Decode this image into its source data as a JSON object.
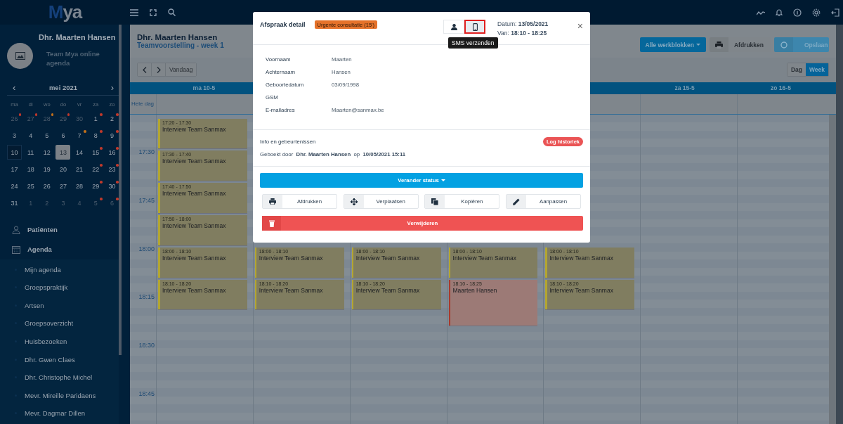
{
  "topbar": {
    "logo": "Mya"
  },
  "sidebar": {
    "profile": {
      "name": "Dhr. Maarten Hansen",
      "subtitle": "Team Mya online agenda"
    },
    "mini_calendar": {
      "month": "mei 2021",
      "prev": "‹",
      "next": "›",
      "weekdays": [
        "ma",
        "di",
        "wo",
        "do",
        "vr",
        "za",
        "zo"
      ],
      "weeks": [
        [
          {
            "day": "26",
            "other_month": true,
            "selected": false,
            "today": false,
            "color": "#c0392b"
          },
          {
            "day": "27",
            "other_month": true,
            "selected": false,
            "today": false,
            "color": "#c0392b"
          },
          {
            "day": "28",
            "other_month": true,
            "selected": false,
            "today": false,
            "color": "#c0701a"
          },
          {
            "day": "29",
            "other_month": true,
            "selected": false,
            "today": false,
            "color": "#c0392b"
          },
          {
            "day": "30",
            "other_month": true,
            "selected": false,
            "today": false
          },
          {
            "day": "1",
            "other_month": false,
            "selected": false,
            "today": false,
            "color": "#c0392b"
          },
          {
            "day": "2",
            "other_month": false,
            "selected": false,
            "today": false,
            "color": "#c0392b"
          }
        ],
        [
          {
            "day": "3",
            "other_month": false,
            "selected": false,
            "today": false
          },
          {
            "day": "4",
            "other_month": false,
            "selected": false,
            "today": false
          },
          {
            "day": "5",
            "other_month": false,
            "selected": false,
            "today": false
          },
          {
            "day": "6",
            "other_month": false,
            "selected": false,
            "today": false
          },
          {
            "day": "7",
            "other_month": false,
            "selected": false,
            "today": false,
            "color": "#c0701a"
          },
          {
            "day": "8",
            "other_month": false,
            "selected": false,
            "today": false,
            "color": "#c0392b"
          },
          {
            "day": "9",
            "other_month": false,
            "selected": false,
            "today": false,
            "color": "#c0392b"
          }
        ],
        [
          {
            "day": "10",
            "other_month": false,
            "selected": false,
            "today": true
          },
          {
            "day": "11",
            "other_month": false,
            "selected": false,
            "today": false
          },
          {
            "day": "12",
            "other_month": false,
            "selected": false,
            "today": false
          },
          {
            "day": "13",
            "other_month": false,
            "selected": true,
            "today": false
          },
          {
            "day": "14",
            "other_month": false,
            "selected": false,
            "today": false
          },
          {
            "day": "15",
            "other_month": false,
            "selected": false,
            "today": false,
            "color": "#c0392b"
          },
          {
            "day": "16",
            "other_month": false,
            "selected": false,
            "today": false,
            "color": "#c0392b"
          }
        ],
        [
          {
            "day": "17",
            "other_month": false,
            "selected": false,
            "today": false
          },
          {
            "day": "18",
            "other_month": false,
            "selected": false,
            "today": false
          },
          {
            "day": "19",
            "other_month": false,
            "selected": false,
            "today": false
          },
          {
            "day": "20",
            "other_month": false,
            "selected": false,
            "today": false
          },
          {
            "day": "21",
            "other_month": false,
            "selected": false,
            "today": false
          },
          {
            "day": "22",
            "other_month": false,
            "selected": false,
            "today": false,
            "color": "#c0392b"
          },
          {
            "day": "23",
            "other_month": false,
            "selected": false,
            "today": false,
            "color": "#c0392b"
          }
        ],
        [
          {
            "day": "24",
            "other_month": false,
            "selected": false,
            "today": false
          },
          {
            "day": "25",
            "other_month": false,
            "selected": false,
            "today": false
          },
          {
            "day": "26",
            "other_month": false,
            "selected": false,
            "today": false
          },
          {
            "day": "27",
            "other_month": false,
            "selected": false,
            "today": false
          },
          {
            "day": "28",
            "other_month": false,
            "selected": false,
            "today": false
          },
          {
            "day": "29",
            "other_month": false,
            "selected": false,
            "today": false,
            "color": "#c0392b"
          },
          {
            "day": "30",
            "other_month": false,
            "selected": false,
            "today": false,
            "color": "#c0392b"
          }
        ],
        [
          {
            "day": "31",
            "other_month": false,
            "selected": false,
            "today": false
          },
          {
            "day": "1",
            "other_month": true,
            "selected": false,
            "today": false
          },
          {
            "day": "2",
            "other_month": true,
            "selected": false,
            "today": false
          },
          {
            "day": "3",
            "other_month": true,
            "selected": false,
            "today": false
          },
          {
            "day": "4",
            "other_month": true,
            "selected": false,
            "today": false
          },
          {
            "day": "5",
            "other_month": true,
            "selected": false,
            "today": false,
            "color": "#c0392b"
          },
          {
            "day": "6",
            "other_month": true,
            "selected": false,
            "today": false,
            "color": "#c0392b"
          }
        ]
      ]
    },
    "nav": [
      {
        "label": "Patiënten",
        "kind": "person"
      },
      {
        "label": "Agenda",
        "kind": "calendar",
        "expanded": true,
        "children": [
          {
            "label": "Mijn agenda"
          },
          {
            "label": "Groepspraktijk"
          },
          {
            "label": "Artsen"
          },
          {
            "label": "Groepsoverzicht"
          },
          {
            "label": "Huisbezoeken"
          },
          {
            "label": "Dhr. Gwen Claes"
          },
          {
            "label": "Dhr. Christophe Michel"
          },
          {
            "label": "Mevr. Mireille Paridaens"
          },
          {
            "label": "Mevr. Dagmar Dillen"
          }
        ]
      }
    ]
  },
  "header": {
    "title": "Dhr. Maarten Hansen",
    "subtitle": "Teamvoorstelling - week 1",
    "buttons": [
      {
        "label": "Alle werkblokken",
        "kind": "dropdown"
      },
      {
        "label": "Afdrukken",
        "kind": "print"
      },
      {
        "label": "Opslaan",
        "kind": "save"
      }
    ]
  },
  "navigation": {
    "today": "Vandaag",
    "views": [
      {
        "label": "Dag",
        "selected": false
      },
      {
        "label": "Week",
        "selected": true
      }
    ]
  },
  "calendar": {
    "allday_label": "Hele dag",
    "times": [
      "17:30",
      "17:45",
      "18:00",
      "18:15",
      "18:30",
      "18:45"
    ],
    "days": [
      {
        "header": "ma 10-5",
        "events": [
          {
            "time": "17:20 - 17:30",
            "title": "Interview Team Sanmax",
            "color": "#b3a631"
          },
          {
            "time": "17:30 - 17:40",
            "title": "Interview Team Sanmax",
            "color": "#b3a631"
          },
          {
            "time": "17:40 - 17:50",
            "title": "Interview Team Sanmax",
            "color": "#b3a631"
          },
          {
            "time": "17:50 - 18:00",
            "title": "Interview Team Sanmax",
            "color": "#b3a631"
          },
          {
            "time": "18:00 - 18:10",
            "title": "Interview Team Sanmax",
            "color": "#b3a631"
          },
          {
            "time": "18:10 - 18:20",
            "title": "Interview Team Sanmax",
            "color": "#b3a631"
          }
        ]
      },
      {
        "events": [
          {
            "time": "18:00 - 18:10",
            "title": "Interview Team Sanmax",
            "color": "#b3a631"
          },
          {
            "time": "18:10 - 18:20",
            "title": "Interview Team Sanmax",
            "color": "#b3a631"
          }
        ]
      },
      {
        "events": [
          {
            "time": "18:00 - 18:10",
            "title": "Interview Team Sanmax",
            "color": "#b3a631"
          },
          {
            "time": "18:10 - 18:20",
            "title": "Interview Team Sanmax",
            "color": "#b3a631"
          }
        ]
      },
      {
        "events": [
          {
            "time": "18:00 - 18:10",
            "title": "Interview Team Sanmax",
            "color": "#b3a631"
          },
          {
            "time": "18:10 - 18:25",
            "title": "Maarten Hansen",
            "color": "#a8392c"
          }
        ]
      },
      {
        "events": [
          {
            "time": "18:00 - 18:10",
            "title": "Interview Team Sanmax",
            "color": "#b3a631"
          },
          {
            "time": "18:10 - 18:20",
            "title": "Interview Team Sanmax",
            "color": "#b3a631"
          }
        ]
      },
      {
        "header": "za 15-5"
      },
      {
        "header": "zo 16-5"
      }
    ]
  },
  "modal": {
    "title": "Afspraak detail",
    "badge": "Urgente consultatie (15')",
    "actions": [
      {
        "kind": "person",
        "selected": false
      },
      {
        "kind": "phone",
        "selected": true,
        "tooltip": "SMS verzenden"
      }
    ],
    "date": "Datum: **13/05/2021**",
    "time": "Van: **18:10 - 18:25**",
    "close": "×",
    "fields": [
      {
        "label": "Voornaam",
        "value": "Maarten"
      },
      {
        "label": "Achternaam",
        "value": "Hansen"
      },
      {
        "label": "Geboortedatum",
        "value": "03/09/1998"
      },
      {
        "label": "GSM"
      },
      {
        "label": "E-mailadres",
        "value": "Maarten@sanmax.be"
      }
    ],
    "info_title": "Info en gebeurtenissen",
    "log_button": "Log historiek",
    "booked": "Geboekt door  **Dhr. Maarten Hansen**  op  **10/05/2021 15:11**",
    "status_button": "Verander status",
    "buttons": [
      {
        "label": "Afdrukken",
        "kind": "print"
      },
      {
        "label": "Verplaatsen",
        "kind": "move"
      },
      {
        "label": "Kopiëren",
        "kind": "copy"
      },
      {
        "label": "Aanpassen",
        "kind": "pencil"
      }
    ],
    "delete_button": "Verwijderen"
  }
}
